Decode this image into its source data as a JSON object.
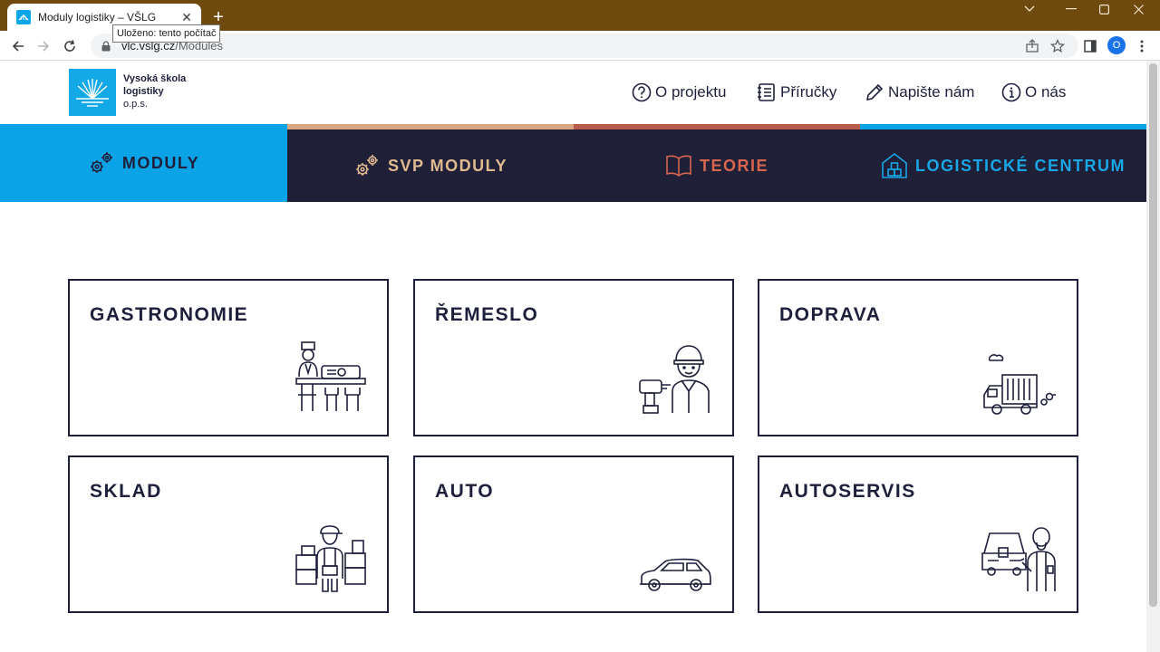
{
  "browser": {
    "tab_title": "Moduly logistiky – VŠLG",
    "url_host": "vlc.vslg.cz",
    "url_path": "/Modules",
    "tooltip": "Uloženo: tento počítač",
    "profile_initial": "O"
  },
  "site": {
    "logo": {
      "line1": "Vysoká škola",
      "line2": "logistiky",
      "line3": "o.p.s."
    },
    "topnav": [
      {
        "label": "O projektu",
        "icon": "question-circle-icon"
      },
      {
        "label": "Příručky",
        "icon": "notebook-icon"
      },
      {
        "label": "Napište nám",
        "icon": "pencil-icon"
      },
      {
        "label": "O nás",
        "icon": "info-circle-icon"
      }
    ],
    "categories": [
      {
        "label": "MODULY",
        "icon": "gears-icon",
        "active": true,
        "color": "#0aa3e6"
      },
      {
        "label": "SVP MODULY",
        "icon": "gears-icon",
        "color": "#e0b98f"
      },
      {
        "label": "TEORIE",
        "icon": "open-book-icon",
        "color": "#d8664f"
      },
      {
        "label": "LOGISTICKÉ CENTRUM",
        "icon": "warehouse-icon",
        "color": "#19a6e4"
      }
    ],
    "modules": [
      {
        "title": "GASTRONOMIE",
        "icon": "cook-at-counter-icon"
      },
      {
        "title": "ŘEMESLO",
        "icon": "worker-with-drill-icon"
      },
      {
        "title": "DOPRAVA",
        "icon": "truck-icon"
      },
      {
        "title": "SKLAD",
        "icon": "warehouse-worker-icon"
      },
      {
        "title": "AUTO",
        "icon": "car-icon"
      },
      {
        "title": "AUTOSERVIS",
        "icon": "mechanic-icon"
      }
    ]
  },
  "colors": {
    "titlebar": "#6e4a0e",
    "navy": "#1f2038",
    "accent_blue": "#0aa3e6"
  }
}
